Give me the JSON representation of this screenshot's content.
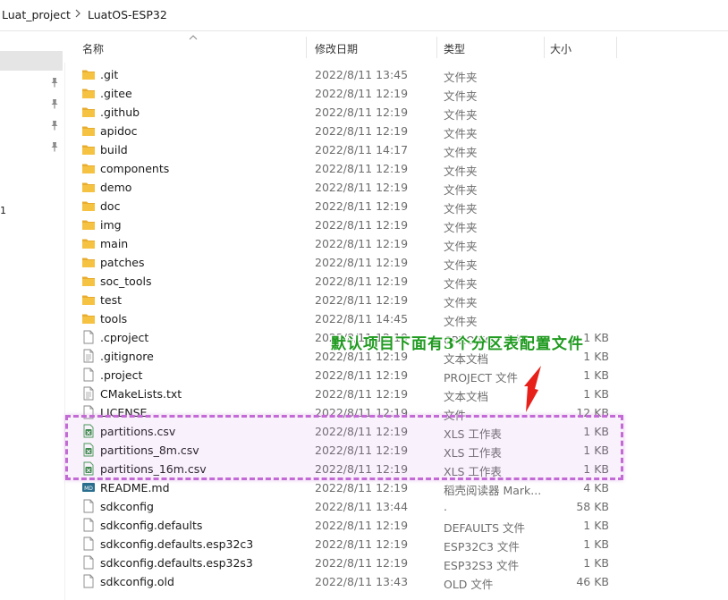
{
  "breadcrumb": {
    "parent": "Luat_project",
    "current": "LuatOS-ESP32"
  },
  "nav_fragment": "1",
  "columns": {
    "name": "名称",
    "date": "修改日期",
    "type": "类型",
    "size": "大小"
  },
  "files": [
    {
      "icon": "folder-icon",
      "name": ".git",
      "date": "2022/8/11 13:45",
      "type": "文件夹",
      "size": ""
    },
    {
      "icon": "folder-icon",
      "name": ".gitee",
      "date": "2022/8/11 12:19",
      "type": "文件夹",
      "size": ""
    },
    {
      "icon": "folder-icon",
      "name": ".github",
      "date": "2022/8/11 12:19",
      "type": "文件夹",
      "size": ""
    },
    {
      "icon": "folder-icon",
      "name": "apidoc",
      "date": "2022/8/11 12:19",
      "type": "文件夹",
      "size": ""
    },
    {
      "icon": "folder-icon",
      "name": "build",
      "date": "2022/8/11 14:17",
      "type": "文件夹",
      "size": ""
    },
    {
      "icon": "folder-icon",
      "name": "components",
      "date": "2022/8/11 12:19",
      "type": "文件夹",
      "size": ""
    },
    {
      "icon": "folder-icon",
      "name": "demo",
      "date": "2022/8/11 12:19",
      "type": "文件夹",
      "size": ""
    },
    {
      "icon": "folder-icon",
      "name": "doc",
      "date": "2022/8/11 12:19",
      "type": "文件夹",
      "size": ""
    },
    {
      "icon": "folder-icon",
      "name": "img",
      "date": "2022/8/11 12:19",
      "type": "文件夹",
      "size": ""
    },
    {
      "icon": "folder-icon",
      "name": "main",
      "date": "2022/8/11 12:19",
      "type": "文件夹",
      "size": ""
    },
    {
      "icon": "folder-icon",
      "name": "patches",
      "date": "2022/8/11 12:19",
      "type": "文件夹",
      "size": ""
    },
    {
      "icon": "folder-icon",
      "name": "soc_tools",
      "date": "2022/8/11 12:19",
      "type": "文件夹",
      "size": ""
    },
    {
      "icon": "folder-icon",
      "name": "test",
      "date": "2022/8/11 12:19",
      "type": "文件夹",
      "size": ""
    },
    {
      "icon": "folder-icon",
      "name": "tools",
      "date": "2022/8/11 14:45",
      "type": "文件夹",
      "size": ""
    },
    {
      "icon": "blank-file-icon",
      "name": ".cproject",
      "date": "2022/8/11 12:19",
      "type": "CPROJECT 文件",
      "size": "1 KB"
    },
    {
      "icon": "text-file-icon",
      "name": ".gitignore",
      "date": "2022/8/11 12:19",
      "type": "文本文档",
      "size": "1 KB"
    },
    {
      "icon": "blank-file-icon",
      "name": ".project",
      "date": "2022/8/11 12:19",
      "type": "PROJECT 文件",
      "size": "1 KB"
    },
    {
      "icon": "text-file-icon",
      "name": "CMakeLists.txt",
      "date": "2022/8/11 12:19",
      "type": "文本文档",
      "size": "1 KB"
    },
    {
      "icon": "blank-file-icon",
      "name": "LICENSE",
      "date": "2022/8/11 12:19",
      "type": "文件",
      "size": "12 KB"
    },
    {
      "icon": "csv-file-icon",
      "name": "partitions.csv",
      "date": "2022/8/11 12:19",
      "type": "XLS 工作表",
      "size": "1 KB"
    },
    {
      "icon": "csv-file-icon",
      "name": "partitions_8m.csv",
      "date": "2022/8/11 12:19",
      "type": "XLS 工作表",
      "size": "1 KB"
    },
    {
      "icon": "csv-file-icon",
      "name": "partitions_16m.csv",
      "date": "2022/8/11 12:19",
      "type": "XLS 工作表",
      "size": "1 KB"
    },
    {
      "icon": "markdown-file-icon",
      "name": "README.md",
      "date": "2022/8/11 12:19",
      "type": "稻壳阅读器 Mark...",
      "size": "4 KB"
    },
    {
      "icon": "blank-file-icon",
      "name": "sdkconfig",
      "date": "2022/8/11 13:44",
      "type": ".",
      "size": "58 KB"
    },
    {
      "icon": "blank-file-icon",
      "name": "sdkconfig.defaults",
      "date": "2022/8/11 12:19",
      "type": "DEFAULTS 文件",
      "size": "1 KB"
    },
    {
      "icon": "blank-file-icon",
      "name": "sdkconfig.defaults.esp32c3",
      "date": "2022/8/11 12:19",
      "type": "ESP32C3 文件",
      "size": "1 KB"
    },
    {
      "icon": "blank-file-icon",
      "name": "sdkconfig.defaults.esp32s3",
      "date": "2022/8/11 12:19",
      "type": "ESP32S3 文件",
      "size": "1 KB"
    },
    {
      "icon": "blank-file-icon",
      "name": "sdkconfig.old",
      "date": "2022/8/11 13:43",
      "type": "OLD 文件",
      "size": "46 KB"
    }
  ],
  "annotation": {
    "text": "默认项目下面有3个分区表配置文件",
    "text_color": "#1f9a1f",
    "highlight_color": "#c36ad6",
    "arrow_color": "#e8201a"
  },
  "colors": {
    "folder": "#f5c242",
    "selection": "#e5e5e5"
  }
}
